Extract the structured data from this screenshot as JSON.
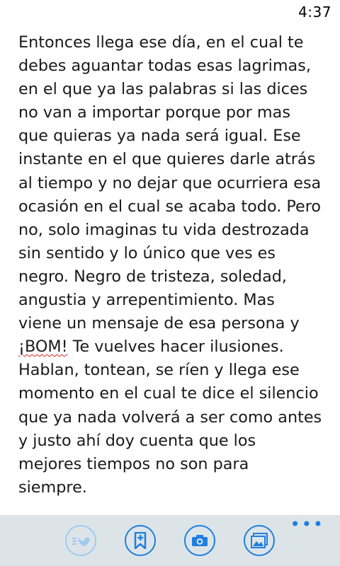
{
  "status_bar": {
    "time": "4:37"
  },
  "note": {
    "lines": [
      "Entonces llega ese día, en el cual te",
      "debes aguantar todas esas lagrimas,",
      "en el que ya las palabras si las dices",
      "no van a importar porque por mas",
      "que quieras ya nada será igual. Ese",
      "instante en el que quieres darle atrás",
      "al tiempo y no dejar que ocurriera esa",
      "ocasión en el cual se acaba todo. Pero",
      "no, solo imaginas tu vida destrozada",
      "sin sentido y lo único que ves es",
      "negro. Negro de tristeza, soledad,",
      "angustia y arrepentimiento. Mas",
      "viene un mensaje de esa persona y",
      "¡BOM! Te vuelves hacer ilusiones.",
      "Hablan, tontean, se ríen y llega ese",
      "momento en el cual te dice el silencio",
      "que ya nada volverá a ser como antes",
      "y justo ahí doy cuenta que los",
      "mejores tiempos no son para",
      "siempre."
    ],
    "misspelled_word": "¡BOM!",
    "line14_rest": " Te vuelves hacer ilusiones."
  },
  "app_bar": {
    "more_label": "•••",
    "buttons": [
      {
        "icon": "twitter-bird-icon",
        "enabled": false
      },
      {
        "icon": "bookmark-plus-icon",
        "enabled": true
      },
      {
        "icon": "camera-icon",
        "enabled": true
      },
      {
        "icon": "picture-gallery-icon",
        "enabled": true
      }
    ]
  },
  "colors": {
    "accent": "#1e7fe0",
    "accent_disabled": "#9ecbee",
    "app_bar_bg": "#dde4e8",
    "text": "#1a1a1a",
    "spell_underline": "#dd2222"
  }
}
